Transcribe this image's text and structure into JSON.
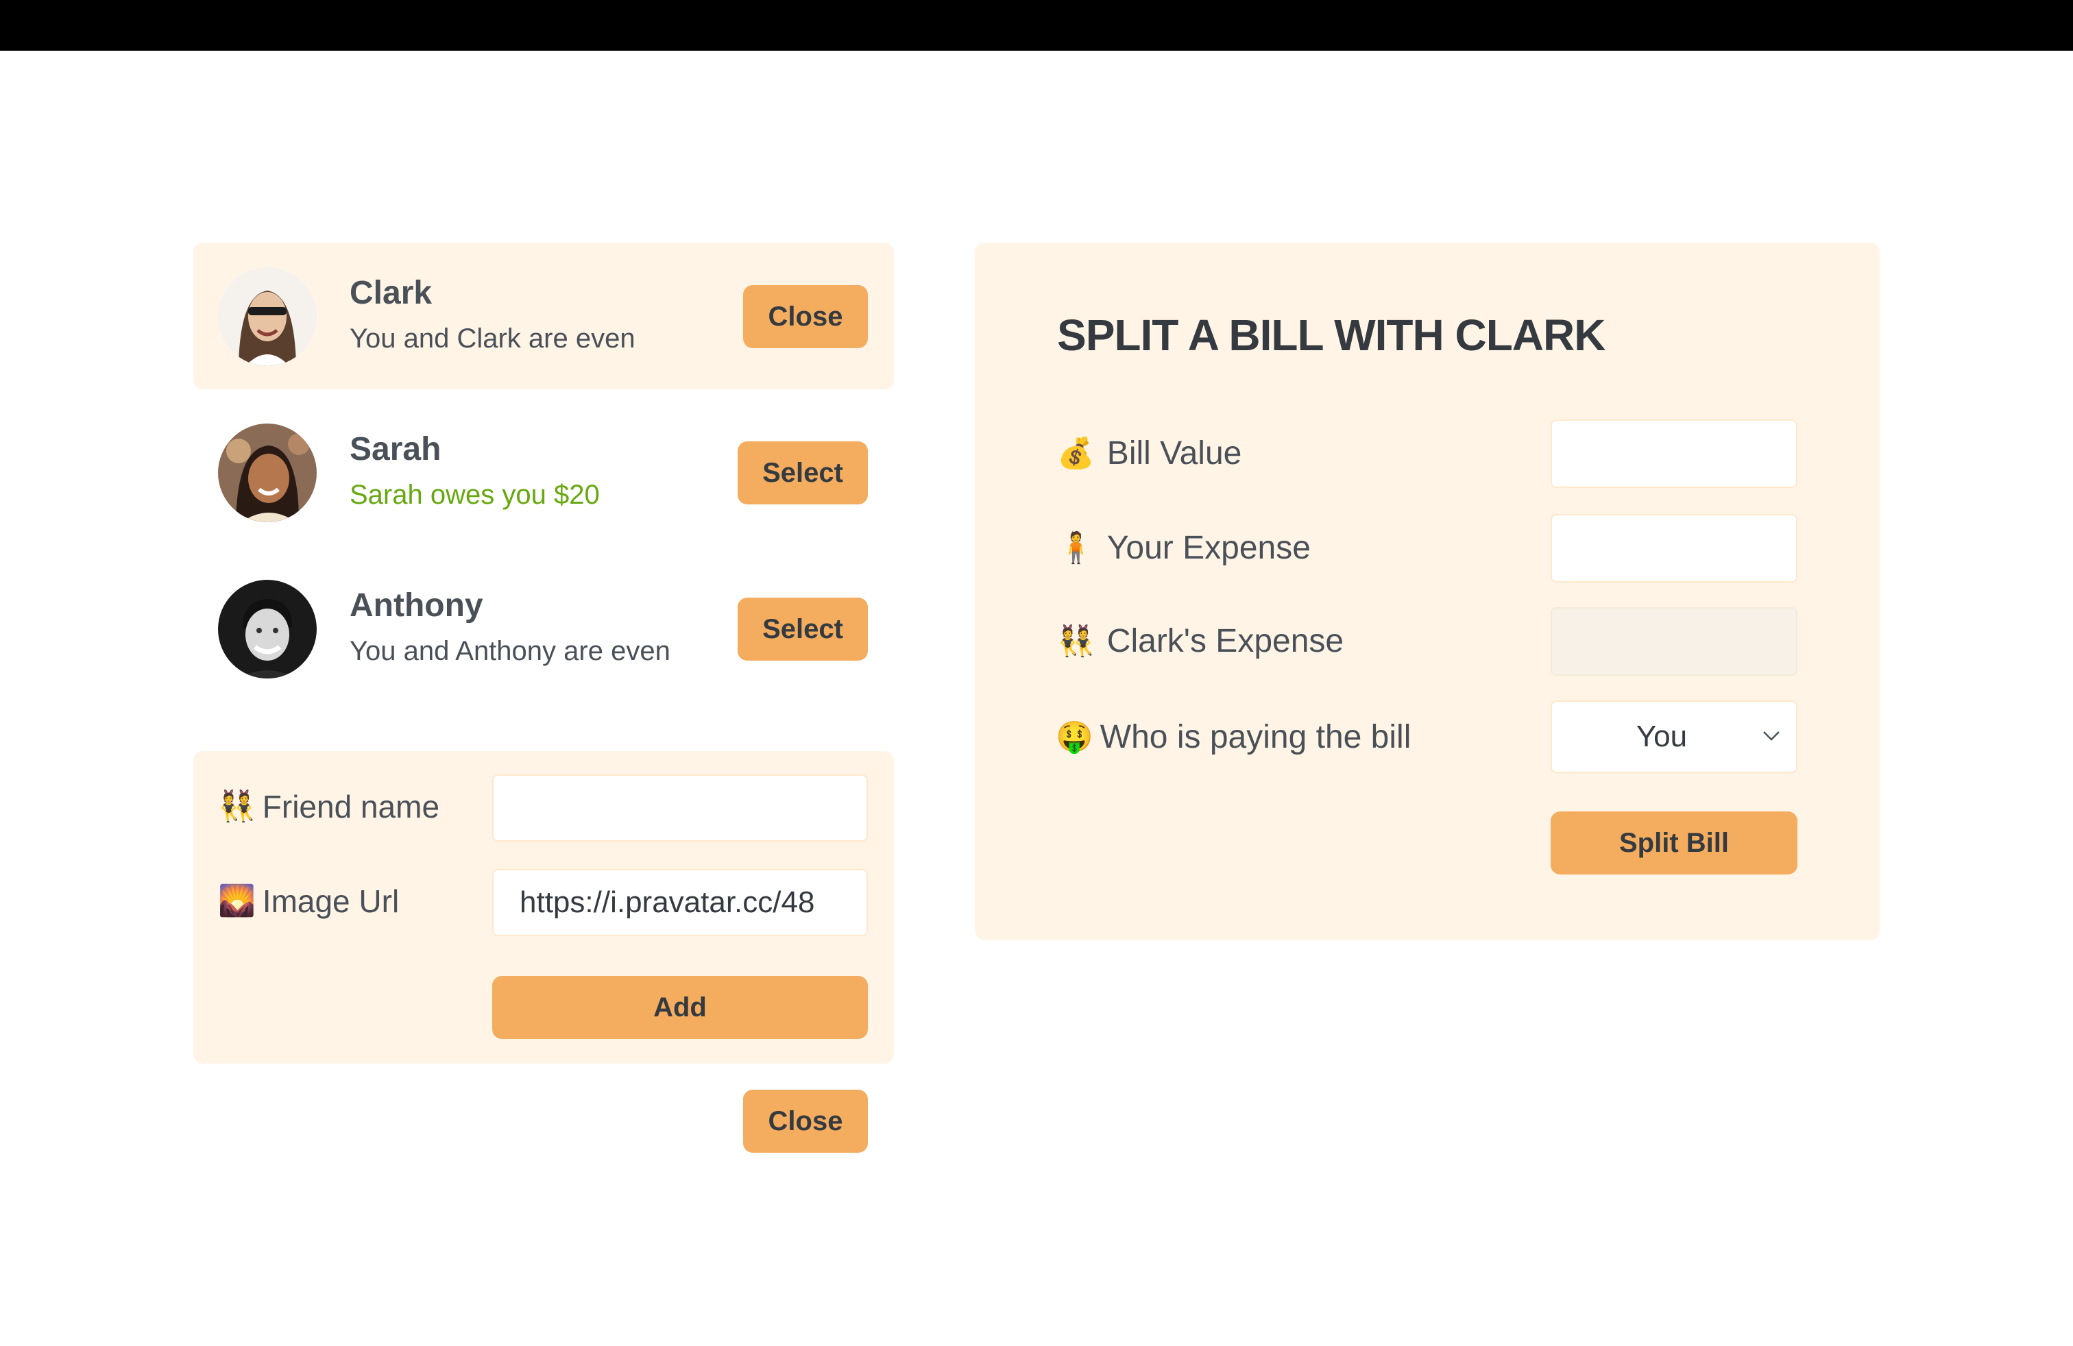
{
  "friends": [
    {
      "name": "Clark",
      "status": "You and Clark are even",
      "status_tone": "neutral",
      "button": "Close",
      "selected": true
    },
    {
      "name": "Sarah",
      "status": "Sarah owes you $20",
      "status_tone": "green",
      "button": "Select",
      "selected": false
    },
    {
      "name": "Anthony",
      "status": "You and Anthony are even",
      "status_tone": "neutral",
      "button": "Select",
      "selected": false
    }
  ],
  "add_form": {
    "name_emoji": "👯",
    "name_label": "Friend name",
    "name_value": "",
    "image_emoji": "🌄",
    "image_label": "Image Url",
    "image_value": "https://i.pravatar.cc/48",
    "add_label": "Add"
  },
  "close_label": "Close",
  "split": {
    "title": "SPLIT A BILL WITH CLARK",
    "bill_emoji": "💰",
    "bill_label": "Bill Value",
    "bill_value": "",
    "expense_emoji": "🧍",
    "expense_label": "Your Expense",
    "expense_value": "",
    "friend_emoji": "👯",
    "friend_label": "Clark's Expense",
    "friend_value": "",
    "payer_emoji": "🤑",
    "payer_label": "Who is paying the bill",
    "payer_value": "You",
    "split_label": "Split Bill"
  },
  "colors": {
    "accent": "#f4ad5e",
    "panel": "#fff4e6",
    "text": "#495057",
    "green": "#66a80f"
  }
}
